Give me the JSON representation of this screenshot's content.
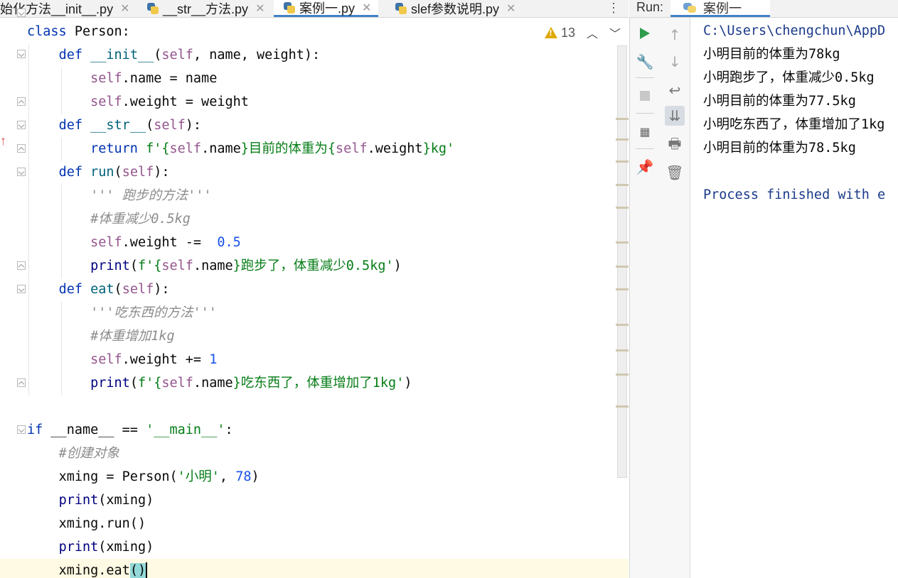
{
  "tabs": [
    {
      "label": "始化方法__init__.py",
      "active": false
    },
    {
      "label": "__str__方法.py",
      "active": false
    },
    {
      "label": "案例一.py",
      "active": true
    },
    {
      "label": "slef参数说明.py",
      "active": false
    }
  ],
  "tabs_menu": "⋮",
  "inspection": {
    "count": "13",
    "icon": "warning-icon"
  },
  "code": {
    "l1": {
      "kw": "class",
      "rest": " Person:"
    },
    "l2": {
      "kw": "def",
      "fn": "__init__",
      "self": "self",
      "rest": ", name, weight):"
    },
    "l3": {
      "self": "self",
      "rest": ".name = name"
    },
    "l4": {
      "self": "self",
      "rest": ".weight = weight"
    },
    "l5": {
      "kw": "def",
      "fn": "__str__",
      "self": "self",
      "rest": "):"
    },
    "l6": {
      "kw": "return",
      "s1": "f'{",
      "self1": "self",
      "r1": ".name",
      "s2": "}目前的体重为{",
      "self2": "self",
      "r2": ".weight",
      "s3": "}kg'"
    },
    "l7": {
      "kw": "def",
      "fn": "run",
      "self": "self",
      "rest": "):"
    },
    "l8": {
      "comment": "''' 跑步的方法'''"
    },
    "l9": {
      "comment": "#体重减少0.5kg"
    },
    "l10": {
      "self": "self",
      "rest": ".weight -=  ",
      "num": "0.5"
    },
    "l11": {
      "builtin": "print",
      "s1": "f'{",
      "self": "self",
      "r1": ".name",
      "s2": "}跑步了，体重减少0.5kg'",
      "close": ")"
    },
    "l12": {
      "kw": "def",
      "fn": "eat",
      "self": "self",
      "rest": "):"
    },
    "l13": {
      "comment": "'''吃东西的方法'''"
    },
    "l14": {
      "comment": "#体重增加1kg"
    },
    "l15": {
      "self": "self",
      "rest": ".weight += ",
      "num": "1"
    },
    "l16": {
      "builtin": "print",
      "s1": "f'{",
      "self": "self",
      "r1": ".name",
      "s2": "}吃东西了，体重增加了1kg'",
      "close": ")"
    },
    "l18": {
      "kw": "if",
      "rest": " __name__ == ",
      "str": "'__main__'",
      "end": ":"
    },
    "l19": {
      "comment": "#创建对象"
    },
    "l20": {
      "pre": "xming = Person(",
      "str": "'小明'",
      "mid": ", ",
      "num": "78",
      "end": ")"
    },
    "l21": {
      "builtin": "print",
      "rest": "(xming)"
    },
    "l22": {
      "text": "xming.run()"
    },
    "l23": {
      "builtin": "print",
      "rest": "(xming)"
    },
    "l24": {
      "pre": "xming.eat",
      "paren": "()"
    }
  },
  "run_panel": {
    "label": "Run:",
    "tab_label": "案例一",
    "toolbar": [
      "rerun-icon",
      "settings-wrench-icon",
      "stop-icon",
      "layout-icon",
      "pin-icon",
      "up-arrow-icon",
      "down-arrow-icon",
      "soft-wrap-icon",
      "scroll-to-end-icon",
      "print-icon",
      "trash-icon"
    ],
    "output": {
      "path": "C:\\Users\\chengchun\\AppD",
      "lines": [
        "小明目前的体重为78kg",
        "小明跑步了，体重减少0.5kg",
        "小明目前的体重为77.5kg",
        "小明吃东西了，体重增加了1kg",
        "小明目前的体重为78.5kg"
      ],
      "finished": "Process finished with e"
    }
  },
  "colors": {
    "keyword": "#0033b3",
    "self": "#94558d",
    "string": "#067d17",
    "number": "#1750eb",
    "comment": "#8c8c8c",
    "accent": "#4083c9",
    "run_green": "#2e9d4b"
  }
}
